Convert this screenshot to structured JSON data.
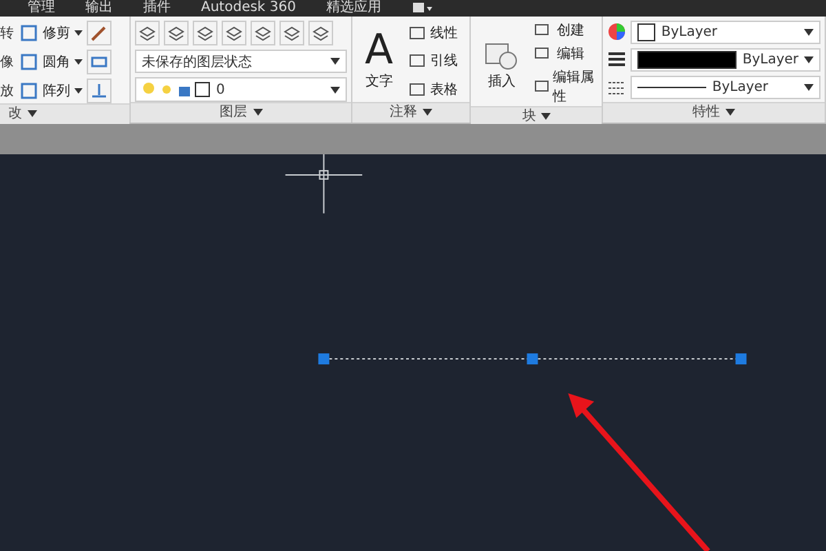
{
  "menu": [
    {
      "label": "管理"
    },
    {
      "label": "输出"
    },
    {
      "label": "插件"
    },
    {
      "label": "Autodesk 360"
    },
    {
      "label": "精选应用"
    }
  ],
  "modify": {
    "cut_labels": [
      "转",
      "像",
      "放"
    ],
    "items": [
      {
        "label": "修剪"
      },
      {
        "label": "圆角"
      },
      {
        "label": "阵列"
      }
    ],
    "title": "改"
  },
  "layers": {
    "state": "未保存的图层状态",
    "current_layer": "0",
    "title": "图层"
  },
  "annotation": {
    "glyph": "A",
    "big": "文字",
    "items": [
      {
        "label": "线性"
      },
      {
        "label": "引线"
      },
      {
        "label": "表格"
      }
    ],
    "title": "注释"
  },
  "block": {
    "insert": "插入",
    "items": [
      {
        "label": "创建"
      },
      {
        "label": "编辑"
      },
      {
        "label": "编辑属性"
      }
    ],
    "title": "块"
  },
  "properties": {
    "color_setting": "ByLayer",
    "lineweight": "ByLayer",
    "linetype": "ByLayer",
    "title": "特性"
  }
}
